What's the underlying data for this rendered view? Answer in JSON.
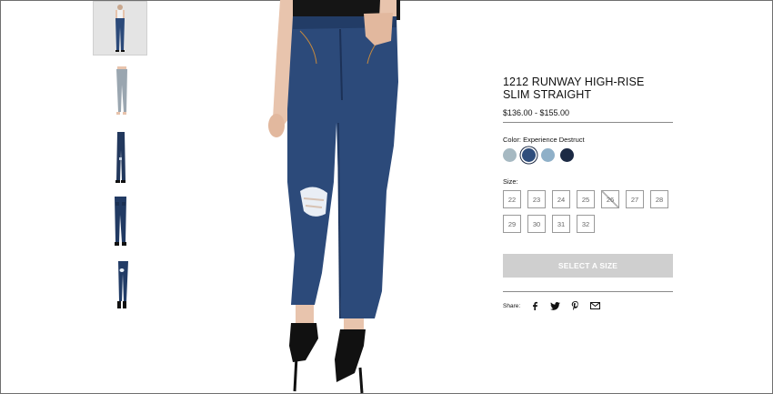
{
  "product": {
    "title": "1212 RUNWAY HIGH-RISE SLIM STRAIGHT",
    "price": "$136.00 - $155.00"
  },
  "color": {
    "label": "Color: Experience Destruct",
    "swatches": [
      {
        "name": "light-wash",
        "hex": "#a6b9c2"
      },
      {
        "name": "experience-destruct",
        "hex": "#2f4e7c",
        "selected": true
      },
      {
        "name": "mid-wash",
        "hex": "#8fb0c8"
      },
      {
        "name": "dark-wash",
        "hex": "#1c2a44"
      }
    ]
  },
  "size": {
    "label": "Size:",
    "options": [
      "22",
      "23",
      "24",
      "25",
      "26",
      "27",
      "28",
      "29",
      "30",
      "31",
      "32"
    ],
    "unavailable": [
      "26"
    ]
  },
  "select_button": {
    "label": "SELECT A SIZE"
  },
  "share": {
    "label": "Share:",
    "icons": [
      "facebook-icon",
      "twitter-icon",
      "pinterest-icon",
      "email-icon"
    ]
  },
  "thumbnails": [
    {
      "name": "front-full-view",
      "active": true
    },
    {
      "name": "light-wash-view"
    },
    {
      "name": "side-view"
    },
    {
      "name": "back-view"
    },
    {
      "name": "detail-view"
    }
  ],
  "colors": {
    "denim": "#2c4a7a",
    "denim_dark": "#223c66",
    "skin": "#e8c4ad",
    "button_disabled": "#cfcfcf",
    "rule": "#8a8a8a"
  }
}
